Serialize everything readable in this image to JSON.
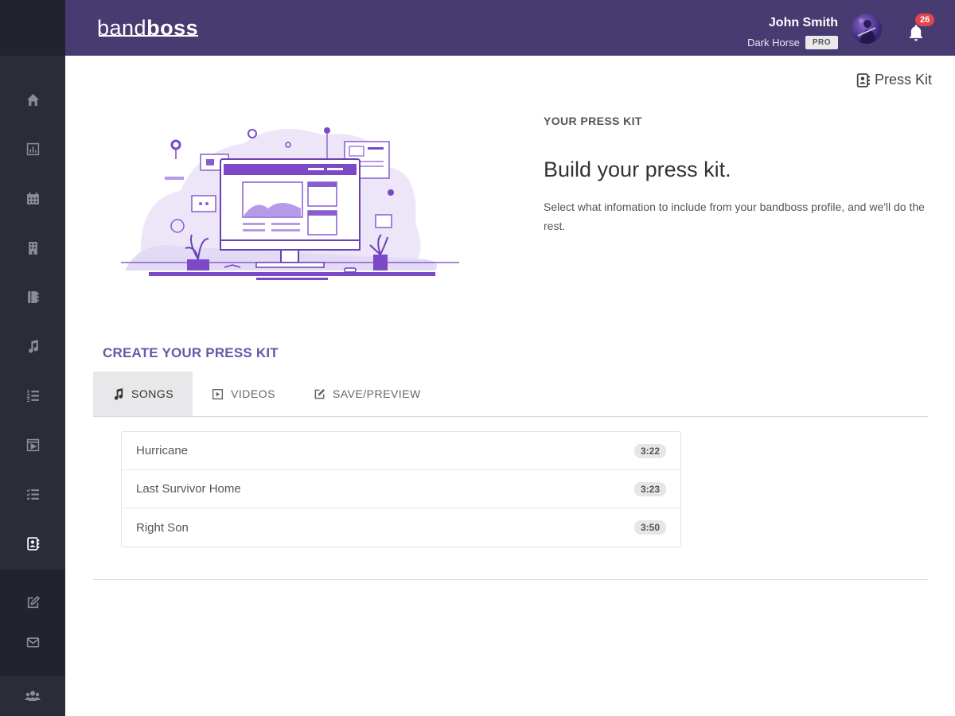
{
  "app": {
    "logo_light": "band",
    "logo_bold": "boss"
  },
  "header": {
    "user_name": "John Smith",
    "band_name": "Dark Horse",
    "plan_badge": "PRO",
    "notification_count": "26"
  },
  "sidebar": {
    "items": [
      {
        "icon": "home-icon"
      },
      {
        "icon": "bar-chart-icon"
      },
      {
        "icon": "calendar-icon"
      },
      {
        "icon": "building-icon"
      },
      {
        "icon": "book-icon"
      },
      {
        "icon": "music-note-icon"
      },
      {
        "icon": "ordered-list-icon"
      },
      {
        "icon": "video-icon"
      },
      {
        "icon": "checklist-icon"
      },
      {
        "icon": "contact-card-icon",
        "active": true
      }
    ],
    "lower_items": [
      {
        "icon": "edit-icon"
      },
      {
        "icon": "mail-icon"
      }
    ],
    "bottom_item": {
      "icon": "users-icon"
    }
  },
  "page": {
    "press_kit_link": "Press Kit",
    "kicker": "YOUR PRESS KIT",
    "headline": "Build your press kit.",
    "intro": "Select what infomation to include from your bandboss profile, and we'll do the rest.",
    "create_title": "CREATE YOUR PRESS KIT"
  },
  "tabs": [
    {
      "label": "SONGS",
      "icon": "music-note-icon",
      "active": true
    },
    {
      "label": "VIDEOS",
      "icon": "video-icon",
      "active": false
    },
    {
      "label": "SAVE/PREVIEW",
      "icon": "edit-icon",
      "active": false
    }
  ],
  "songs": [
    {
      "title": "Hurricane",
      "duration": "3:22"
    },
    {
      "title": "Last Survivor Home",
      "duration": "3:23"
    },
    {
      "title": "Right Son",
      "duration": "3:50"
    }
  ],
  "colors": {
    "header_bg": "#473b72",
    "sidebar_bg": "#2a2d38",
    "accent_purple": "#6a56a8",
    "illustration_purple": "#8a5cd1",
    "badge_red": "#e0474c"
  }
}
